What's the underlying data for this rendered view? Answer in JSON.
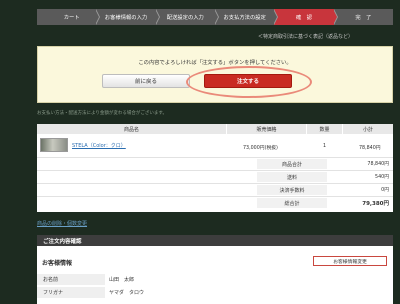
{
  "steps": [
    "カート",
    "お客様情報の入力",
    "配送設定の入力",
    "お支払方法の設定",
    "確　認",
    "完　了"
  ],
  "spec_link": "＜特定商取引法に基づく表記（返品など）",
  "confirm": {
    "message": "この内容でよろしければ「注文する」ボタンを押してください。",
    "back_label": "前に戻る",
    "order_label": "注文する"
  },
  "note": "お支払い方法・配送方法により金額が変わる場合がございます。",
  "cart": {
    "headers": [
      "商品名",
      "販売価格",
      "数量",
      "小計"
    ],
    "item": {
      "name": "STELA（Color：クロ）",
      "price": "73,000円(税抜)",
      "qty": "1",
      "subtotal": "78,840円"
    },
    "summary": [
      {
        "label": "商品合計",
        "value": "78,840円"
      },
      {
        "label": "送料",
        "value": "540円"
      },
      {
        "label": "決済手数料",
        "value": "0円"
      },
      {
        "label": "総合計",
        "value": "79,380円"
      }
    ]
  },
  "edit_link": "商品の削除・個数変更",
  "details": {
    "header": "ご注文内容確認",
    "customer_title": "お客様情報",
    "customer_edit": "お客様情報変更",
    "fields": [
      {
        "label": "お名前",
        "value": "山田　太郎"
      },
      {
        "label": "フリガナ",
        "value": "ヤマダ　タロウ"
      }
    ]
  },
  "colors": {
    "accent": "#c92b22",
    "step_active": "#c8353c",
    "background": "#1d2b20"
  }
}
